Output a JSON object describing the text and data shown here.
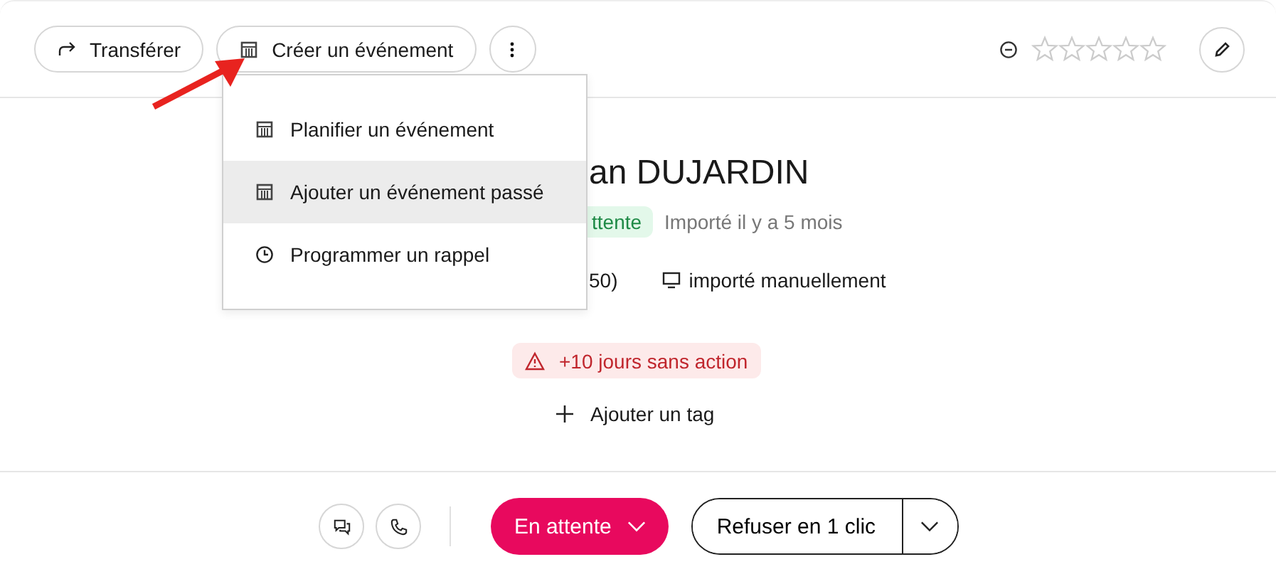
{
  "toolbar": {
    "buttons": [
      {
        "label": "Transférer",
        "kind": "forward"
      },
      {
        "label": "Créer un événement",
        "kind": "calendar"
      }
    ]
  },
  "rating": {
    "stars": 0
  },
  "menu": {
    "items": [
      {
        "label": "Planifier un événement",
        "kind": "calendar",
        "selected": false
      },
      {
        "label": "Ajouter un événement passé",
        "kind": "calendar",
        "selected": true
      },
      {
        "label": "Programmer un rappel",
        "kind": "clock",
        "selected": false
      }
    ]
  },
  "candidate": {
    "name": "an DUJARDIN",
    "status": "ttente",
    "imported": "Importé il y a 5 mois",
    "info_1": "50)",
    "source": "importé manuellement"
  },
  "alert": "+10 jours sans action",
  "add_tag": "Ajouter un tag",
  "footer": {
    "status_button": "En attente",
    "refuse_button": "Refuser en 1 clic"
  }
}
